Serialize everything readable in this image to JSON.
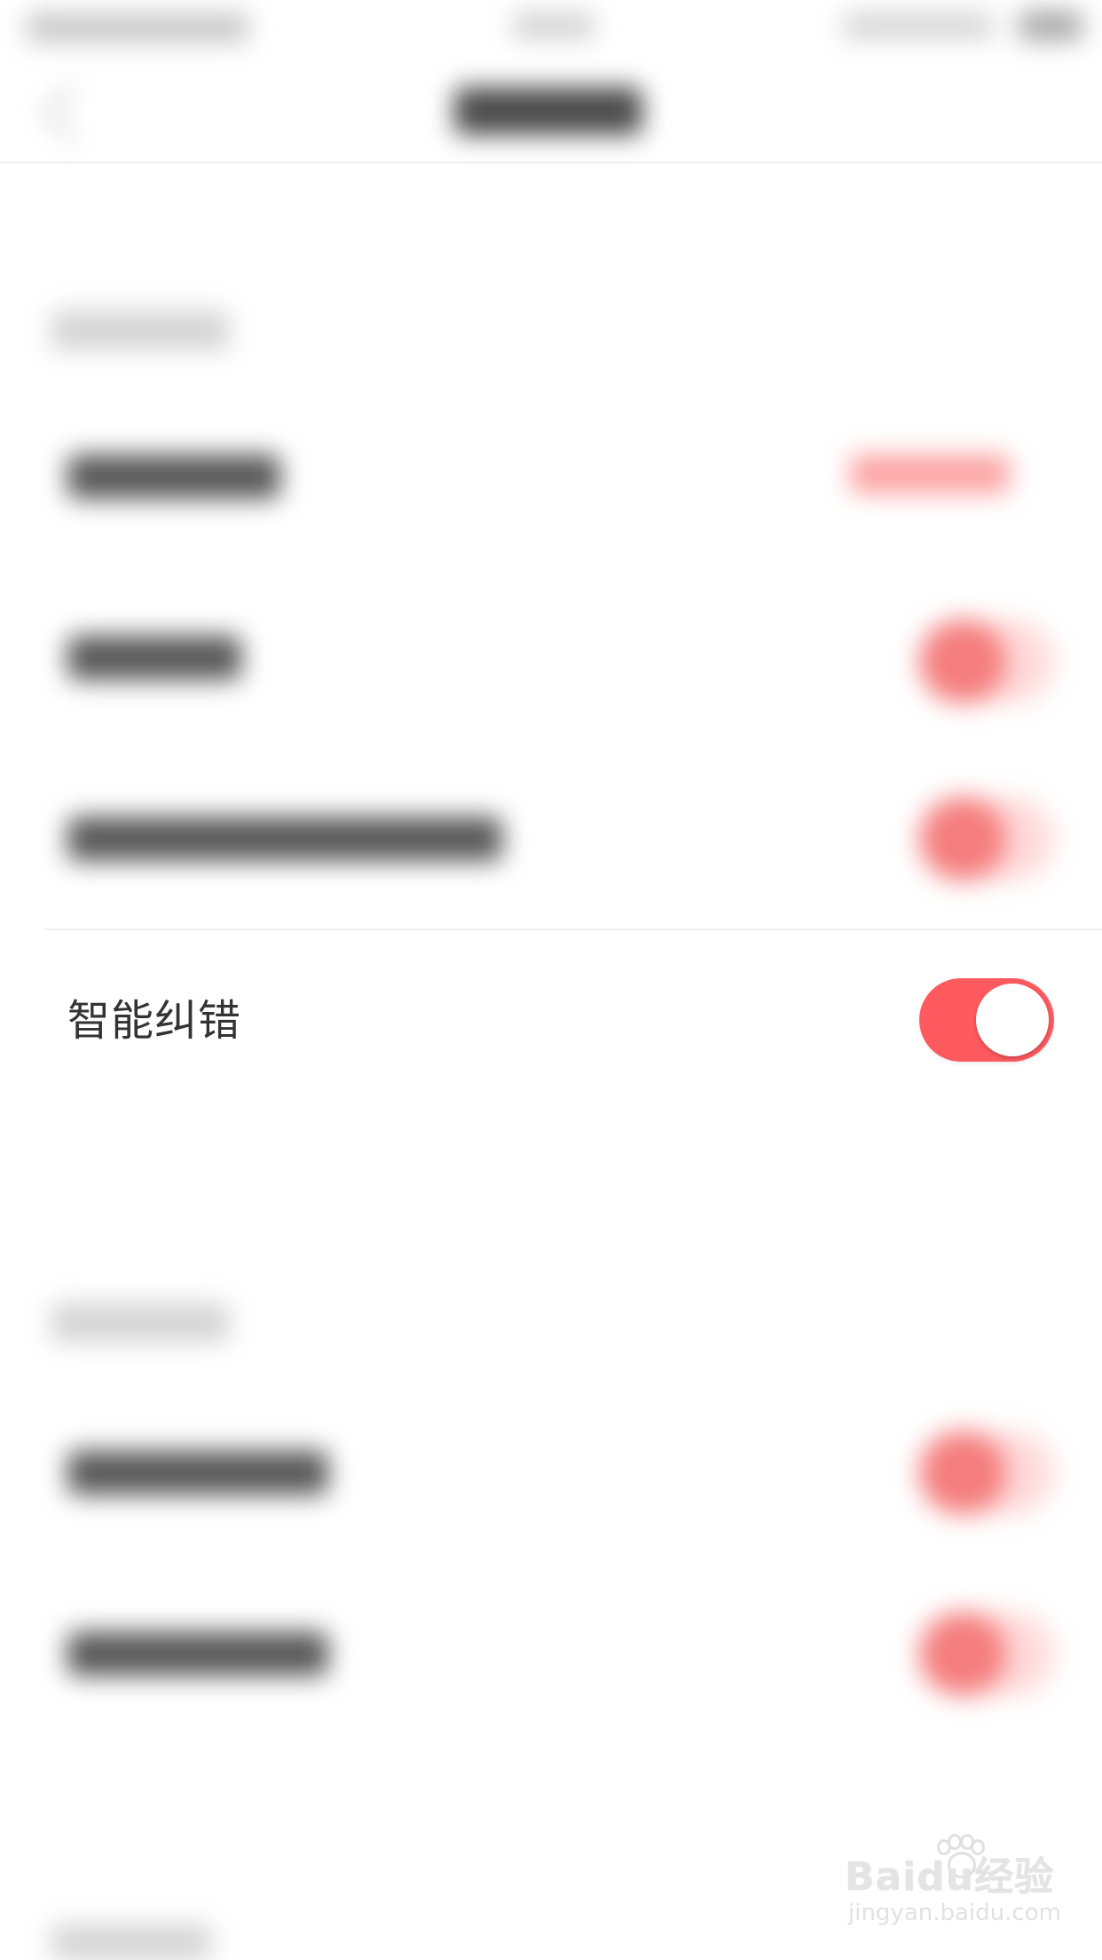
{
  "settings": {
    "focused_row": {
      "label": "智能纠错",
      "toggle_on": true
    }
  },
  "colors": {
    "accent": "#ff5a5f",
    "toggle_knob": "#ffffff",
    "label_text": "#333333"
  },
  "watermark": {
    "logo": "Baidu经验",
    "url": "jingyan.baidu.com"
  }
}
